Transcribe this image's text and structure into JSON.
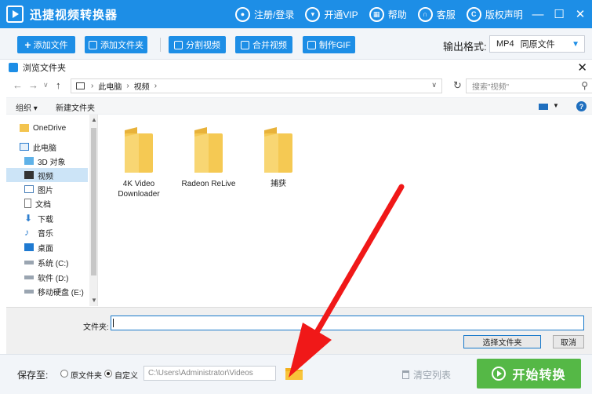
{
  "app": {
    "title": "迅捷视频转换器",
    "links": [
      {
        "icon": "user-icon",
        "label": "注册/登录"
      },
      {
        "icon": "vip-cart-icon",
        "label": "开通VIP"
      },
      {
        "icon": "help-grid-icon",
        "label": "帮助"
      },
      {
        "icon": "headset-icon",
        "label": "客服"
      },
      {
        "icon": "copyright-icon",
        "label": "版权声明"
      }
    ],
    "window_controls": {
      "minimize": "—",
      "maximize": "☐",
      "close": "✕"
    }
  },
  "toolbar": {
    "add_file": "添加文件",
    "add_folder": "添加文件夹",
    "split_video": "分割视频",
    "merge_video": "合并视频",
    "make_gif": "制作GIF",
    "output_format_label": "输出格式:",
    "output_format_value": "MP4",
    "output_format_quality": "同原文件"
  },
  "dialog": {
    "title": "浏览文件夹",
    "breadcrumb": [
      "此电脑",
      "视频"
    ],
    "search_placeholder": "搜索\"视频\"",
    "organize": "组织 ▾",
    "new_folder": "新建文件夹",
    "nav_items": [
      {
        "label": "OneDrive",
        "icon": "folder-icon"
      },
      {
        "label": "此电脑",
        "icon": "computer-icon"
      },
      {
        "label": "3D 对象",
        "icon": "cube-icon"
      },
      {
        "label": "视频",
        "icon": "video-icon",
        "selected": true
      },
      {
        "label": "图片",
        "icon": "picture-icon"
      },
      {
        "label": "文档",
        "icon": "document-icon"
      },
      {
        "label": "下载",
        "icon": "download-icon"
      },
      {
        "label": "音乐",
        "icon": "music-icon"
      },
      {
        "label": "桌面",
        "icon": "desktop-icon"
      },
      {
        "label": "系统 (C:)",
        "icon": "drive-icon"
      },
      {
        "label": "软件 (D:)",
        "icon": "drive-icon"
      },
      {
        "label": "移动硬盘 (E:)",
        "icon": "drive-icon"
      }
    ],
    "folders": [
      {
        "line1": "4K Video",
        "line2": "Downloader"
      },
      {
        "line1": "Radeon ReLive",
        "line2": ""
      },
      {
        "line1": "捕获",
        "line2": ""
      }
    ],
    "filename_label": "文件夹:",
    "filename_value": "",
    "select_button": "选择文件夹",
    "cancel_button": "取消"
  },
  "bottom": {
    "save_to": "保存至:",
    "option_original": "原文件夹",
    "option_custom": "自定义",
    "selected_option": "custom",
    "path": "C:\\Users\\Administrator\\Videos",
    "clear_list": "清空列表",
    "start": "开始转换"
  },
  "colors": {
    "brand_blue": "#1d8ee6",
    "start_green": "#55b846",
    "annotation_red": "#f01818"
  }
}
